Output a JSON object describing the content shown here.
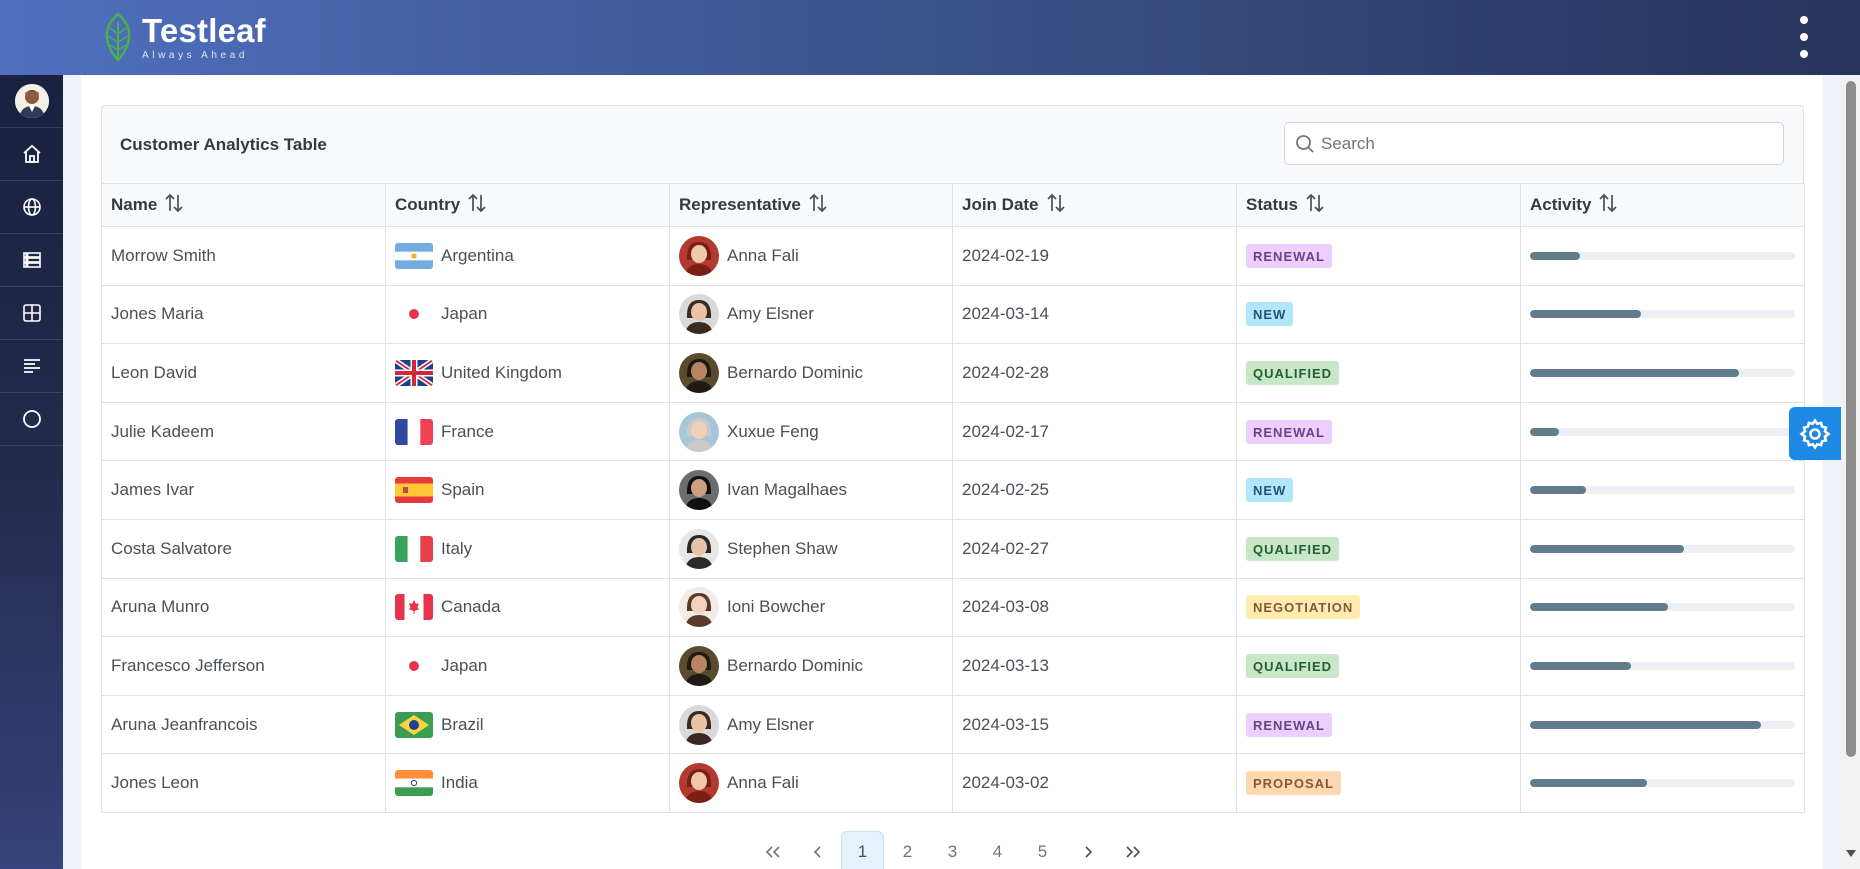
{
  "brand": {
    "title": "Testleaf",
    "tagline": "Always Ahead"
  },
  "sidebar": {
    "items": [
      {
        "name": "profile",
        "icon": "user-avatar"
      },
      {
        "name": "home",
        "icon": "home-icon"
      },
      {
        "name": "globe",
        "icon": "globe-icon"
      },
      {
        "name": "server",
        "icon": "server-icon"
      },
      {
        "name": "grid",
        "icon": "grid-icon"
      },
      {
        "name": "align-left",
        "icon": "align-left-icon"
      },
      {
        "name": "circle",
        "icon": "circle-icon"
      }
    ]
  },
  "table": {
    "title": "Customer Analytics Table",
    "search_placeholder": "Search",
    "columns": [
      "Name",
      "Country",
      "Representative",
      "Join Date",
      "Status",
      "Activity"
    ],
    "rows": [
      {
        "name": "Morrow Smith",
        "country": "Argentina",
        "flag": "ar",
        "representative": "Anna Fali",
        "avatar": "a1",
        "join_date": "2024-02-19",
        "status": "RENEWAL",
        "activity": 0.19
      },
      {
        "name": "Jones Maria",
        "country": "Japan",
        "flag": "jp",
        "representative": "Amy Elsner",
        "avatar": "a2",
        "join_date": "2024-03-14",
        "status": "NEW",
        "activity": 0.42
      },
      {
        "name": "Leon David",
        "country": "United Kingdom",
        "flag": "gb",
        "representative": "Bernardo Dominic",
        "avatar": "a3",
        "join_date": "2024-02-28",
        "status": "QUALIFIED",
        "activity": 0.79
      },
      {
        "name": "Julie Kadeem",
        "country": "France",
        "flag": "fr",
        "representative": "Xuxue Feng",
        "avatar": "a4",
        "join_date": "2024-02-17",
        "status": "RENEWAL",
        "activity": 0.11
      },
      {
        "name": "James Ivar",
        "country": "Spain",
        "flag": "es",
        "representative": "Ivan Magalhaes",
        "avatar": "a5",
        "join_date": "2024-02-25",
        "status": "NEW",
        "activity": 0.21
      },
      {
        "name": "Costa Salvatore",
        "country": "Italy",
        "flag": "it",
        "representative": "Stephen Shaw",
        "avatar": "a6",
        "join_date": "2024-02-27",
        "status": "QUALIFIED",
        "activity": 0.58
      },
      {
        "name": "Aruna Munro",
        "country": "Canada",
        "flag": "ca",
        "representative": "Ioni Bowcher",
        "avatar": "a7",
        "join_date": "2024-03-08",
        "status": "NEGOTIATION",
        "activity": 0.52
      },
      {
        "name": "Francesco Jefferson",
        "country": "Japan",
        "flag": "jp",
        "representative": "Bernardo Dominic",
        "avatar": "a3",
        "join_date": "2024-03-13",
        "status": "QUALIFIED",
        "activity": 0.38
      },
      {
        "name": "Aruna Jeanfrancois",
        "country": "Brazil",
        "flag": "br",
        "representative": "Amy Elsner",
        "avatar": "a2",
        "join_date": "2024-03-15",
        "status": "RENEWAL",
        "activity": 0.87
      },
      {
        "name": "Jones Leon",
        "country": "India",
        "flag": "in",
        "representative": "Anna Fali",
        "avatar": "a1",
        "join_date": "2024-03-02",
        "status": "PROPOSAL",
        "activity": 0.44
      }
    ]
  },
  "status_colors": {
    "RENEWAL": {
      "bg": "#eccfff",
      "fg": "#694382"
    },
    "NEW": {
      "bg": "#b3e5fc",
      "fg": "#23547b"
    },
    "QUALIFIED": {
      "bg": "#c8e6c9",
      "fg": "#256029"
    },
    "NEGOTIATION": {
      "bg": "#feedaf",
      "fg": "#8a5340"
    },
    "PROPOSAL": {
      "bg": "#ffd8b2",
      "fg": "#805b36"
    }
  },
  "pagination": {
    "pages": [
      "1",
      "2",
      "3",
      "4",
      "5"
    ],
    "current": "1"
  },
  "colors": {
    "accent": "#1e88e5",
    "activity_fill": "#607d8b"
  }
}
